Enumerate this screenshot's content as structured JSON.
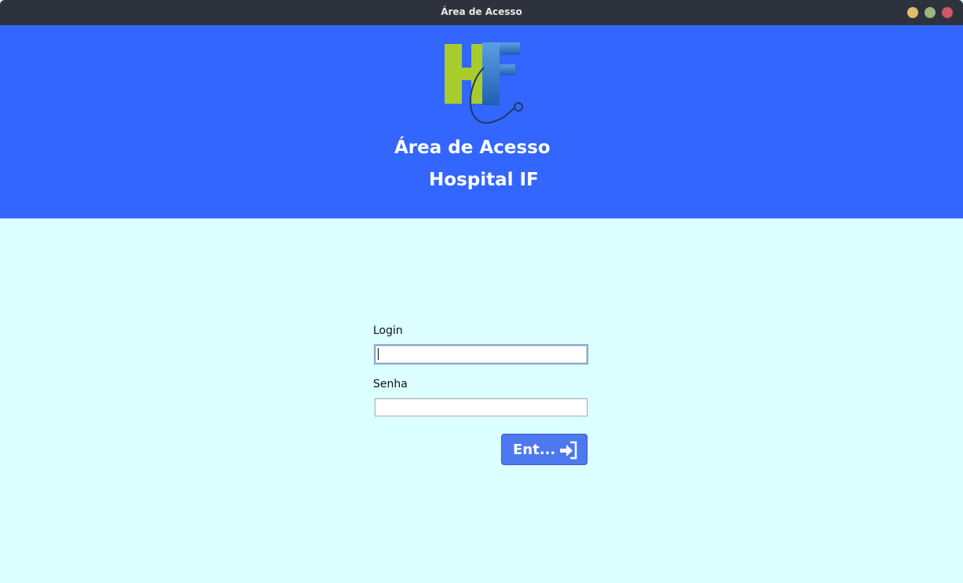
{
  "window": {
    "title": "Área de Acesso"
  },
  "header": {
    "title": "Área de Acesso",
    "subtitle": "Hospital IF",
    "logo_icon": "hospital-if-logo",
    "background_color": "#3366ff"
  },
  "form": {
    "login_label": "Login",
    "login_value": "",
    "senha_label": "Senha",
    "senha_value": "",
    "submit_label": "Ent...",
    "submit_icon": "enter-icon"
  },
  "colors": {
    "body_background": "#dcffff",
    "titlebar": "#2e323c",
    "button": "#4d79f0",
    "logo_green": "#a8cc2c",
    "logo_blue": "#1f5fb5"
  }
}
